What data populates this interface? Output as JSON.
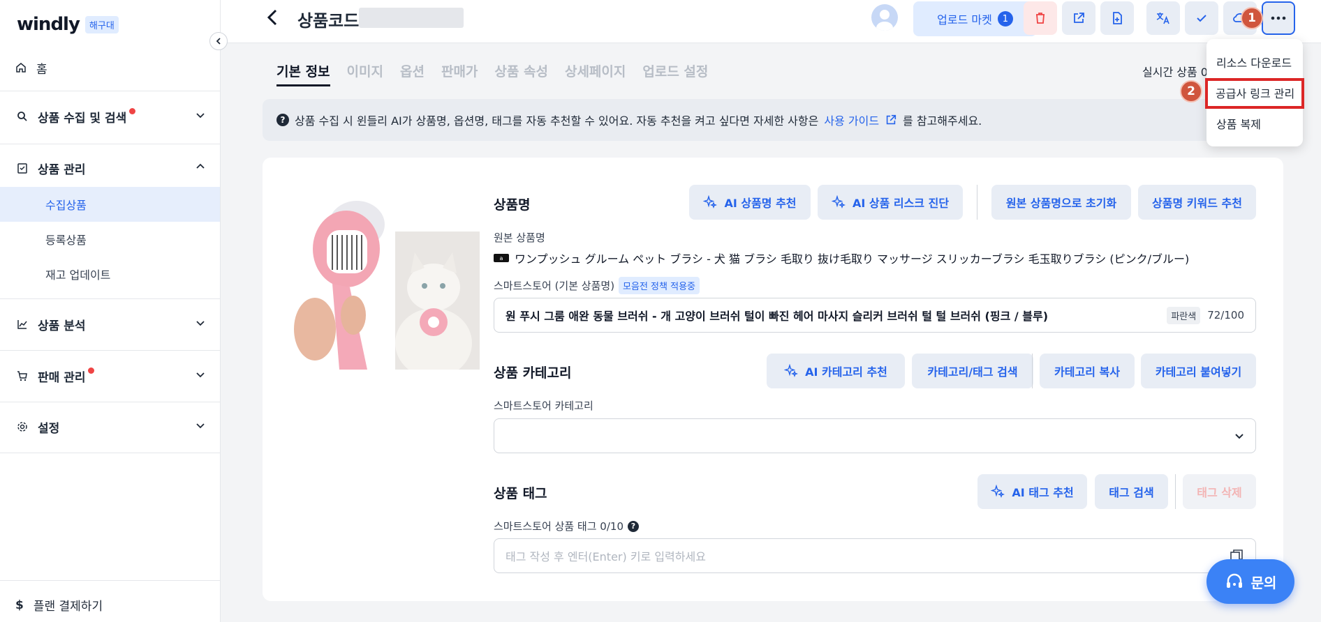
{
  "sidebar": {
    "brand": "windly",
    "brand_tag": "해구대",
    "home": "홈",
    "groups": [
      {
        "label": "상품 수집 및 검색"
      },
      {
        "label": "상품 관리"
      },
      {
        "label": "상품 분석"
      },
      {
        "label": "판매 관리"
      },
      {
        "label": "설정"
      }
    ],
    "sub_items": [
      "수집상품",
      "등록상품",
      "재고 업데이트"
    ],
    "plan": "플랜 결제하기"
  },
  "header": {
    "title": "상품코드",
    "upload_label": "업로드 마켓",
    "upload_count": "1"
  },
  "tabs": [
    "기본 정보",
    "이미지",
    "옵션",
    "판매가",
    "상품 속성",
    "상세페이지",
    "업로드 설정"
  ],
  "realtime_label": "실시간 상품 0",
  "info": {
    "text": "상품 수집 시 윈들리 AI가 상품명, 옵션명, 태그를 자동 추천할 수 있어요. 자동 추천을 켜고 싶다면 자세한 사항은",
    "link": "사용 가이드",
    "suffix": "를 참고해주세요."
  },
  "product_name": {
    "title": "상품명",
    "btn_ai_name": "AI 상품명 추천",
    "btn_ai_risk": "AI 상품 리스크 진단",
    "btn_reset": "원본 상품명으로 초기화",
    "btn_keyword": "상품명 키워드 추천",
    "original_label": "원본 상품명",
    "flag": "a",
    "original_value": "ワンプッシュ グルーム ペット ブラシ - 犬 猫 ブラシ 毛取り 抜け毛取り マッサージ スリッカーブラシ 毛玉取りブラシ (ピンク/ブルー)",
    "smartstore_label": "스마트스토어 (기본 상품명)",
    "policy_badge": "모음전 정책 적용중",
    "value": "원 푸시 그룸 애완 동물 브러쉬 - 개 고양이 브러쉬 털이 빠진 헤어 마사지 슬리커 브러쉬 털 털 브러쉬 (핑크 / 블루)",
    "chip": "파란색",
    "count": "72/100"
  },
  "category": {
    "title": "상품 카테고리",
    "btn_ai": "AI 카테고리 추천",
    "btn_search": "카테고리/태그 검색",
    "btn_copy": "카테고리 복사",
    "btn_paste": "카테고리 붙여넣기",
    "label": "스마트스토어 카테고리"
  },
  "tags": {
    "title": "상품 태그",
    "btn_ai": "AI 태그 추천",
    "btn_search": "태그 검색",
    "btn_delete": "태그 삭제",
    "label": "스마트스토어 상품 태그 0/10",
    "placeholder": "태그 작성 후 엔터(Enter) 키로 입력하세요"
  },
  "menu": {
    "items": [
      "리소스 다운로드",
      "공급사 링크 관리",
      "상품 복제"
    ]
  },
  "steps": [
    "1",
    "2"
  ],
  "chat_label": "문의",
  "colors": {
    "accent": "#2563eb",
    "danger": "#ef4444",
    "step": "#d0553d"
  }
}
